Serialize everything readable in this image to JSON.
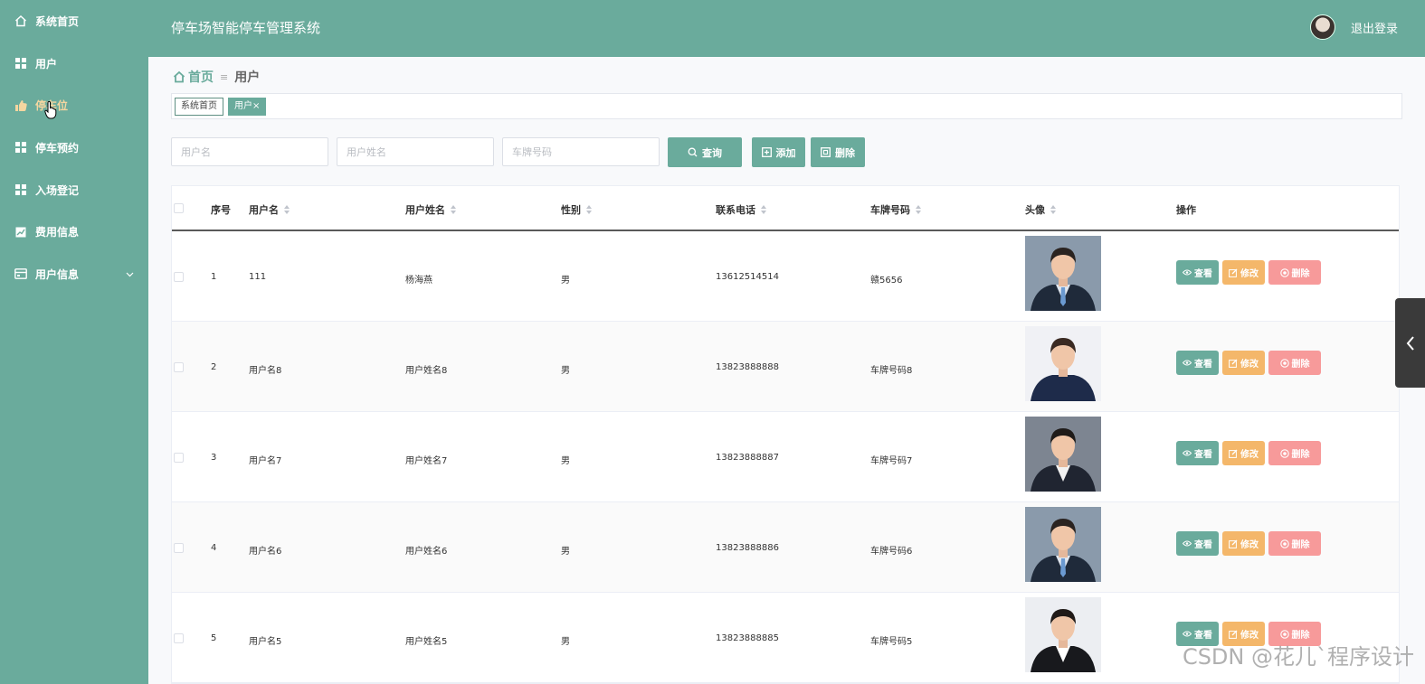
{
  "colors": {
    "primary": "#6aab9c",
    "edit": "#f4b76a",
    "delete": "#f79a9a"
  },
  "sidebar": {
    "items": [
      {
        "label": "系统首页",
        "icon": "home-icon"
      },
      {
        "label": "用户",
        "icon": "grid-icon"
      },
      {
        "label": "停车位",
        "icon": "thumb-icon"
      },
      {
        "label": "停车预约",
        "icon": "grid-icon"
      },
      {
        "label": "入场登记",
        "icon": "grid-icon"
      },
      {
        "label": "费用信息",
        "icon": "chart-icon"
      },
      {
        "label": "用户信息",
        "icon": "card-icon"
      }
    ]
  },
  "header": {
    "title": "停车场智能停车管理系统",
    "logout": "退出登录"
  },
  "breadcrumb": {
    "home": "首页",
    "separator": "≡",
    "current": "用户"
  },
  "tags": [
    {
      "label": "系统首页"
    },
    {
      "label": "用户×"
    }
  ],
  "search": {
    "username_placeholder": "用户名",
    "realname_placeholder": "用户姓名",
    "plate_placeholder": "车牌号码",
    "query_label": "查询",
    "add_label": "添加",
    "delete_label": "删除"
  },
  "table": {
    "headers": [
      "序号",
      "用户名",
      "用户姓名",
      "性别",
      "联系电话",
      "车牌号码",
      "头像",
      "操作"
    ],
    "rows": [
      {
        "no": "1",
        "username": "111",
        "realname": "杨海燕",
        "gender": "男",
        "phone": "13612514514",
        "plate": "赣5656"
      },
      {
        "no": "2",
        "username": "用户名8",
        "realname": "用户姓名8",
        "gender": "男",
        "phone": "13823888888",
        "plate": "车牌号码8"
      },
      {
        "no": "3",
        "username": "用户名7",
        "realname": "用户姓名7",
        "gender": "男",
        "phone": "13823888887",
        "plate": "车牌号码7"
      },
      {
        "no": "4",
        "username": "用户名6",
        "realname": "用户姓名6",
        "gender": "男",
        "phone": "13823888886",
        "plate": "车牌号码6"
      },
      {
        "no": "5",
        "username": "用户名5",
        "realname": "用户姓名5",
        "gender": "男",
        "phone": "13823888885",
        "plate": "车牌号码5"
      }
    ],
    "actions": {
      "view": "查看",
      "edit": "修改",
      "delete": "删除"
    }
  },
  "watermark": "CSDN @花儿`程序设计"
}
